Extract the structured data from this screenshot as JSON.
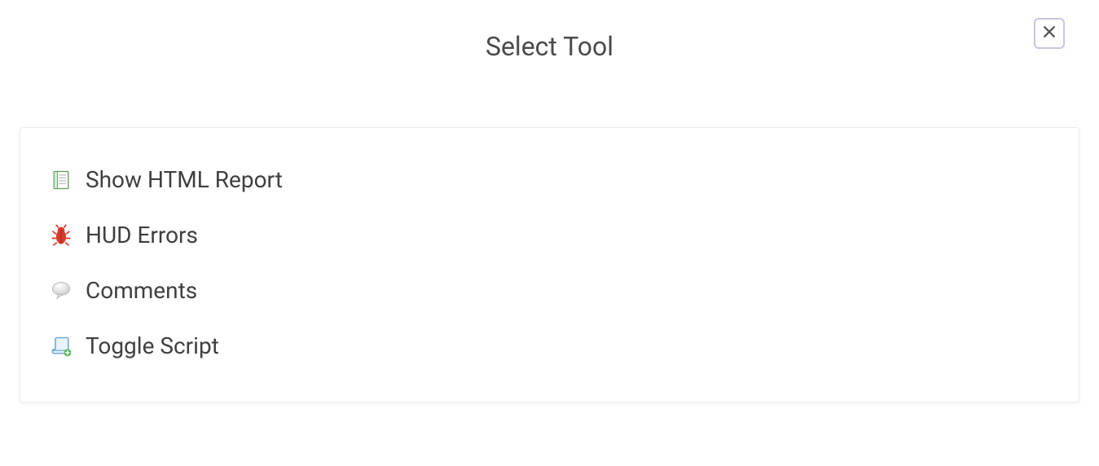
{
  "dialog": {
    "title": "Select Tool",
    "close_aria": "Close"
  },
  "tools": [
    {
      "icon": "notepad-icon",
      "label": "Show HTML Report"
    },
    {
      "icon": "bug-icon",
      "label": "HUD Errors"
    },
    {
      "icon": "comment-icon",
      "label": "Comments"
    },
    {
      "icon": "script-icon",
      "label": "Toggle Script"
    }
  ]
}
